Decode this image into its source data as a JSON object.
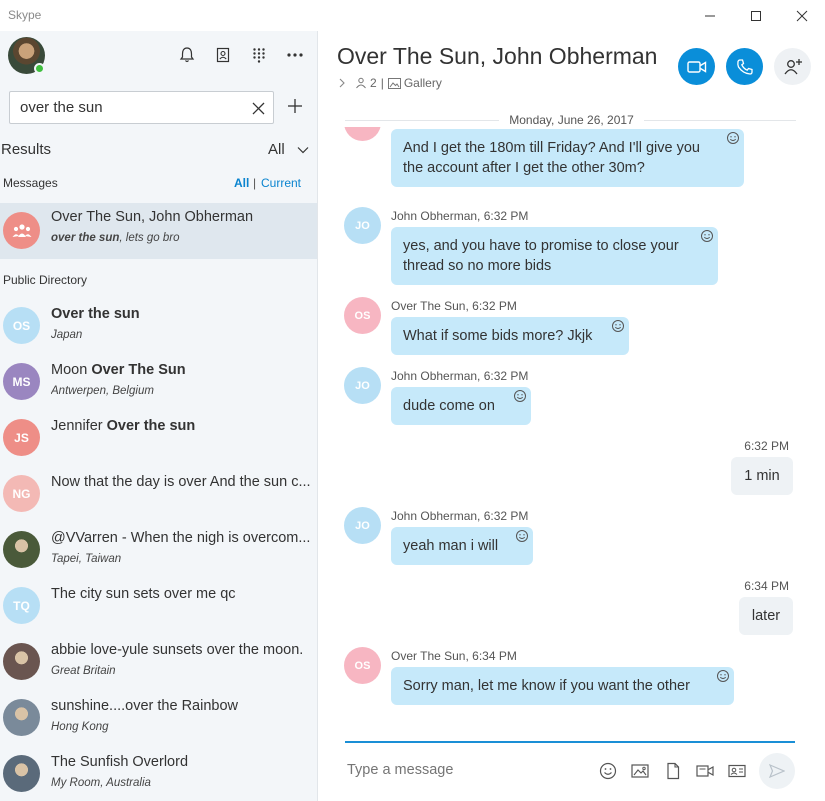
{
  "window": {
    "title": "Skype"
  },
  "sidebar": {
    "search": {
      "value": "over the sun",
      "placeholder": ""
    },
    "results": {
      "label": "Results",
      "filter": "All"
    },
    "messages_section": {
      "label": "Messages",
      "filter_all": "All",
      "separator": "|",
      "filter_current": "Current"
    },
    "conversation": {
      "title": "Over The Sun, John Obherman",
      "preview_bold": "over the sun",
      "preview_rest": ", lets go bro"
    },
    "directory_label": "Public Directory",
    "directory": [
      {
        "initials": "OS",
        "color": "#b7dff5",
        "title_plain": "",
        "title_bold": "Over the sun",
        "subtitle": "Japan"
      },
      {
        "initials": "MS",
        "color": "#9a86c0",
        "title_plain": "Moon ",
        "title_bold": "Over The Sun",
        "subtitle": "Antwerpen, Belgium"
      },
      {
        "initials": "JS",
        "color": "#ee8e87",
        "title_plain": "Jennifer ",
        "title_bold": "Over the sun",
        "subtitle": ""
      },
      {
        "initials": "NG",
        "color": "#f3b9b5",
        "title_plain": "Now that the day is over And the sun c...",
        "title_bold": "",
        "subtitle": ""
      },
      {
        "initials": "",
        "color": "#4a5a3a",
        "title_plain": "@VVarren - When the nigh is overcom...",
        "title_bold": "",
        "subtitle": "Tapei, Taiwan"
      },
      {
        "initials": "TQ",
        "color": "#b7dff5",
        "title_plain": "The city sun sets over me qc",
        "title_bold": "",
        "subtitle": ""
      },
      {
        "initials": "",
        "color": "#6a5550",
        "title_plain": "abbie love-yule  sunsets over the moon.",
        "title_bold": "",
        "subtitle": "Great Britain"
      },
      {
        "initials": "",
        "color": "#7a8a9a",
        "title_plain": "sunshine....over the Rainbow",
        "title_bold": "",
        "subtitle": "Hong Kong"
      },
      {
        "initials": "",
        "color": "#5a6a7a",
        "title_plain": "The Sunfish Overlord",
        "title_bold": "",
        "subtitle": "My Room, Australia"
      }
    ]
  },
  "main": {
    "title": "Over The Sun, John Obherman",
    "participants": "2",
    "gallery_label": "Gallery",
    "date": "Monday, June 26, 2017",
    "messages": [
      {
        "dir": "in",
        "initials": "OS",
        "sender": "",
        "time": "",
        "text": "And I get the 180m till Friday? And I'll give you the account after I get the other 30m?"
      },
      {
        "dir": "in",
        "initials": "JO",
        "sender": "John Obherman,",
        "time": "6:32 PM",
        "text": "yes, and you have to promise to close your thread so no more bids"
      },
      {
        "dir": "in",
        "initials": "OS",
        "sender": "Over The Sun,",
        "time": "6:32 PM",
        "text": "What if some bids more? Jkjk"
      },
      {
        "dir": "in",
        "initials": "JO",
        "sender": "John Obherman,",
        "time": "6:32 PM",
        "text": "dude come on"
      },
      {
        "dir": "out",
        "initials": "",
        "sender": "",
        "time": "6:32 PM",
        "text": "1 min"
      },
      {
        "dir": "in",
        "initials": "JO",
        "sender": "John Obherman,",
        "time": "6:32 PM",
        "text": "yeah man i will"
      },
      {
        "dir": "out",
        "initials": "",
        "sender": "",
        "time": "6:34 PM",
        "text": "later"
      },
      {
        "dir": "in",
        "initials": "OS",
        "sender": "Over The Sun,",
        "time": "6:34 PM",
        "text": "Sorry man, let me know if you want the other"
      }
    ],
    "compose": {
      "placeholder": "Type a message"
    }
  },
  "colors": {
    "accent": "#0a8ed9",
    "bubble_in": "#c6e9fa",
    "bubble_out": "#eef2f5",
    "selected_row": "#dfe7ee",
    "presence": "#3fbf3f"
  }
}
